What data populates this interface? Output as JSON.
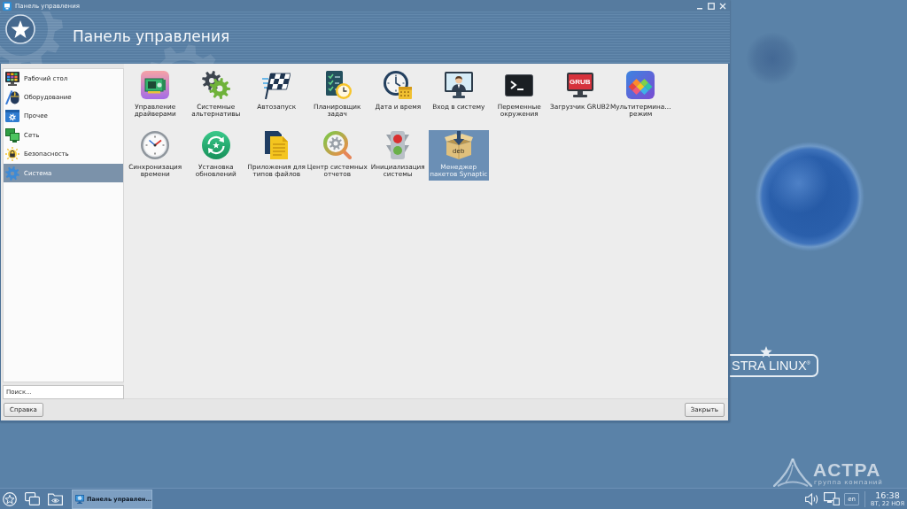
{
  "window": {
    "title": "Панель управления"
  },
  "header": {
    "title": "Панель управления"
  },
  "sidebar": {
    "items": [
      {
        "kind": "desktop",
        "label": "Рабочий стол",
        "selected": false
      },
      {
        "kind": "hardware",
        "label": "Оборудование",
        "selected": false
      },
      {
        "kind": "other",
        "label": "Прочее",
        "selected": false
      },
      {
        "kind": "network",
        "label": "Сеть",
        "selected": false
      },
      {
        "kind": "security",
        "label": "Безопасность",
        "selected": false
      },
      {
        "kind": "system",
        "label": "Система",
        "selected": true
      }
    ]
  },
  "search": {
    "placeholder": "Поиск..."
  },
  "apps": [
    {
      "kind": "drivers",
      "label": "Управление\nдрайверами",
      "selected": false
    },
    {
      "kind": "alternatives",
      "label": "Системные\nальтернативы",
      "selected": false
    },
    {
      "kind": "autostart",
      "label": "Автозапуск",
      "selected": false
    },
    {
      "kind": "scheduler",
      "label": "Планировщик\nзадач",
      "selected": false
    },
    {
      "kind": "datetime",
      "label": "Дата и время",
      "selected": false
    },
    {
      "kind": "login",
      "label": "Вход в систему",
      "selected": false
    },
    {
      "kind": "environment",
      "label": "Переменные\nокружения",
      "selected": false
    },
    {
      "kind": "bootloader",
      "label": "Загрузчик GRUB2",
      "icon_text": "GRUB",
      "selected": false
    },
    {
      "kind": "multiterminal",
      "label": "Мультитермина…\nрежим",
      "selected": false
    },
    {
      "kind": "timesync",
      "label": "Синхронизация\nвремени",
      "selected": false
    },
    {
      "kind": "updates",
      "label": "Установка\nобновлений",
      "selected": false
    },
    {
      "kind": "filetypes",
      "label": "Приложения для\nтипов файлов",
      "selected": false
    },
    {
      "kind": "reports",
      "label": "Центр системных\nотчетов",
      "selected": false
    },
    {
      "kind": "init",
      "label": "Инициализация\nсистемы",
      "selected": false
    },
    {
      "kind": "packages",
      "label": "Менеджер\nпакетов Synaptic",
      "icon_text": "deb",
      "selected": true
    }
  ],
  "buttons": [
    {
      "label": "Справка"
    },
    {
      "label": "Закрыть"
    }
  ],
  "desktop": {
    "os_logo": "STRA LINUX$^{®}$",
    "brand": "АСТРА",
    "brand_tagline": "группа компаний"
  },
  "taskbar": {
    "tasks": [
      {
        "label": "Панель управлен…",
        "selected": true
      }
    ],
    "language": "en",
    "time": "16:38",
    "date": "ВТ, 22 НОЯ"
  }
}
